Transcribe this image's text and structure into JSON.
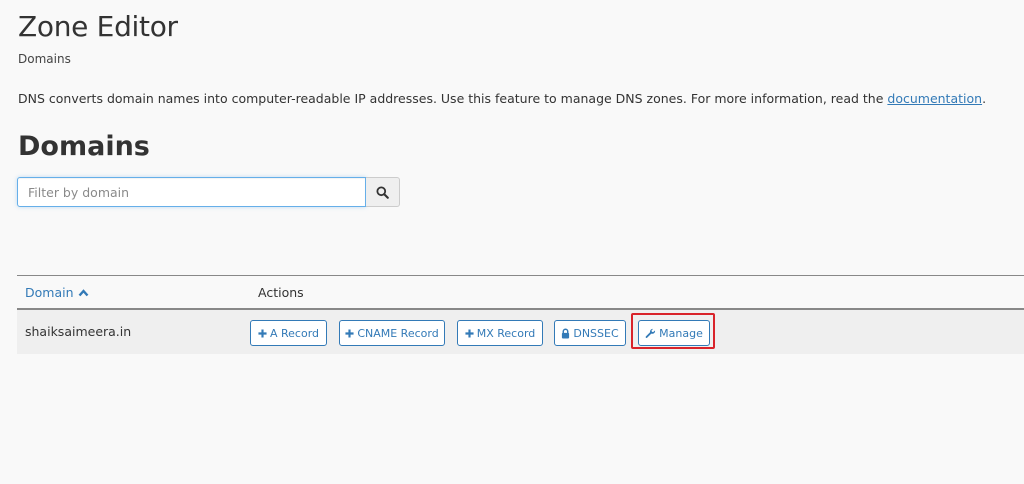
{
  "header": {
    "title": "Zone Editor",
    "breadcrumb": "Domains"
  },
  "intro": {
    "text": "DNS converts domain names into computer-readable IP addresses. Use this feature to manage DNS zones. For more information, read the ",
    "link_label": "documentation",
    "suffix": "."
  },
  "domains_section": {
    "title": "Domains",
    "search": {
      "placeholder": "Filter by domain",
      "value": "",
      "button_icon": "search-icon"
    }
  },
  "table": {
    "columns": [
      {
        "label": "Domain",
        "sort": "ascending",
        "sort_icon": "chevron-up-icon"
      },
      {
        "label": "Actions"
      }
    ],
    "rows": [
      {
        "domain": "shaiksaimeera.in",
        "actions": [
          {
            "label": "A Record",
            "icon": "plus-icon"
          },
          {
            "label": "CNAME Record",
            "icon": "plus-icon"
          },
          {
            "label": "MX Record",
            "icon": "plus-icon"
          },
          {
            "label": "DNSSEC",
            "icon": "lock-icon"
          },
          {
            "label": "Manage",
            "icon": "wrench-icon",
            "highlighted": true
          }
        ]
      }
    ]
  },
  "colors": {
    "link": "#337ab7",
    "highlight": "#d9232a",
    "background": "#f9f9f9",
    "row_background": "#efefef"
  }
}
